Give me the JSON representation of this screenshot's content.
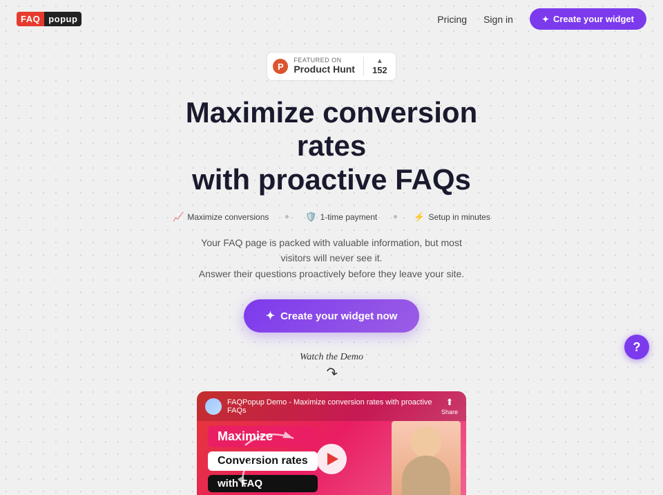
{
  "nav": {
    "logo_faq": "FAQ",
    "logo_popup": "popup",
    "pricing_label": "Pricing",
    "signin_label": "Sign in",
    "create_widget_label": "Create your widget"
  },
  "product_hunt": {
    "featured_label": "FEATURED ON",
    "name": "Product Hunt",
    "arrow": "▲",
    "count": "152"
  },
  "hero": {
    "headline_line1": "Maximize conversion rates",
    "headline_line2": "with proactive FAQs",
    "feature1": "Maximize conversions",
    "feature2": "1-time payment",
    "feature3": "Setup in minutes",
    "subtext_line1": "Your FAQ page is packed with valuable information, but most visitors will never see it.",
    "subtext_line2": "Answer their questions proactively before they leave your site.",
    "cta_label": "Create your widget now",
    "watch_demo": "Watch the Demo"
  },
  "video": {
    "title": "FAQPopup Demo - Maximize conversion rates with proactive FAQs",
    "share_label": "Share",
    "badge_maximize": "Maximize",
    "badge_conversion": "Conversion rates",
    "badge_faq": "with FAQ"
  },
  "help": {
    "label": "?"
  }
}
